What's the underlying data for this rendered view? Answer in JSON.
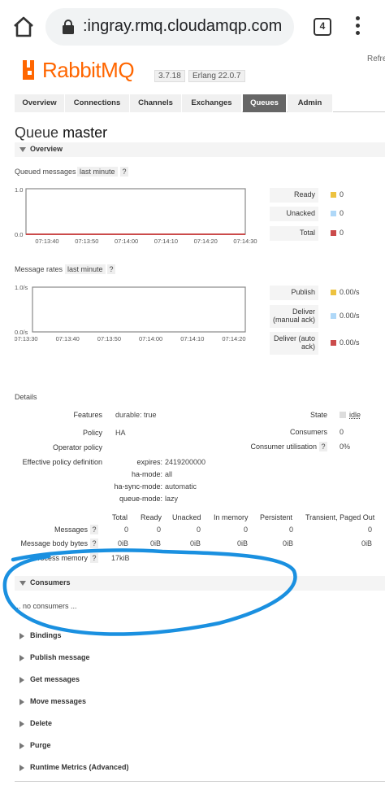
{
  "browser": {
    "url": ":ingray.rmq.cloudamqp.com",
    "tab_count": "4",
    "home_icon": "home-icon",
    "lock_icon": "lock-icon",
    "menu_icon": "kebab-menu-icon"
  },
  "header": {
    "logo_text": "RabbitMQ",
    "version": "3.7.18",
    "erlang": "Erlang 22.0.7",
    "refresh": "Refre"
  },
  "tabs": [
    "Overview",
    "Connections",
    "Channels",
    "Exchanges",
    "Queues",
    "Admin"
  ],
  "active_tab": "Queues",
  "page": {
    "title_prefix": "Queue",
    "title_name": "master"
  },
  "overview": {
    "label": "Overview",
    "queued_messages": {
      "label": "Queued messages",
      "range": "last minute",
      "help": "?",
      "y_top": "1.0",
      "y_bottom": "0.0",
      "x_ticks": [
        "07:13:40",
        "07:13:50",
        "07:14:00",
        "07:14:10",
        "07:14:20",
        "07:14:30"
      ],
      "legend": [
        {
          "label": "Ready",
          "value": "0",
          "color": "#edc240"
        },
        {
          "label": "Unacked",
          "value": "0",
          "color": "#afd8f8"
        },
        {
          "label": "Total",
          "value": "0",
          "color": "#cb4b4b"
        }
      ]
    },
    "message_rates": {
      "label": "Message rates",
      "range": "last minute",
      "help": "?",
      "y_top": "1.0/s",
      "y_bottom": "0.0/s",
      "x_ticks": [
        "07:13:30",
        "07:13:40",
        "07:13:50",
        "07:14:00",
        "07:14:10",
        "07:14:20"
      ],
      "legend": [
        {
          "label": "Publish",
          "value": "0.00/s",
          "color": "#edc240"
        },
        {
          "label": "Deliver (manual ack)",
          "value": "0.00/s",
          "color": "#afd8f8"
        },
        {
          "label": "Deliver (auto ack)",
          "value": "0.00/s",
          "color": "#cb4b4b"
        }
      ]
    }
  },
  "details": {
    "label": "Details",
    "features_label": "Features",
    "features_value": "durable: true",
    "policy_label": "Policy",
    "policy_value": "HA",
    "operator_policy_label": "Operator policy",
    "effective_policy_label": "Effective policy definition",
    "effective_policy": [
      {
        "k": "expires:",
        "v": "2419200000"
      },
      {
        "k": "ha-mode:",
        "v": "all"
      },
      {
        "k": "ha-sync-mode:",
        "v": "automatic"
      },
      {
        "k": "queue-mode:",
        "v": "lazy"
      }
    ],
    "state_label": "State",
    "state_value": "idle",
    "consumers_label": "Consumers",
    "consumers_value": "0",
    "consumer_util_label": "Consumer utilisation",
    "consumer_util_help": "?",
    "consumer_util_value": "0%",
    "table_headers": [
      "Total",
      "Ready",
      "Unacked",
      "In memory",
      "Persistent",
      "Transient, Paged Out"
    ],
    "rows": [
      {
        "label": "Messages",
        "help": "?",
        "values": [
          "0",
          "0",
          "0",
          "0",
          "0",
          "0"
        ]
      },
      {
        "label": "Message body bytes",
        "help": "?",
        "values": [
          "0iB",
          "0iB",
          "0iB",
          "0iB",
          "0iB",
          "0iB"
        ]
      },
      {
        "label": "Process memory",
        "help": "?",
        "values": [
          "17kiB"
        ]
      }
    ]
  },
  "consumers": {
    "label": "Consumers",
    "empty": "... no consumers ..."
  },
  "sections": [
    "Bindings",
    "Publish message",
    "Get messages",
    "Move messages",
    "Delete",
    "Purge",
    "Runtime Metrics (Advanced)"
  ]
}
